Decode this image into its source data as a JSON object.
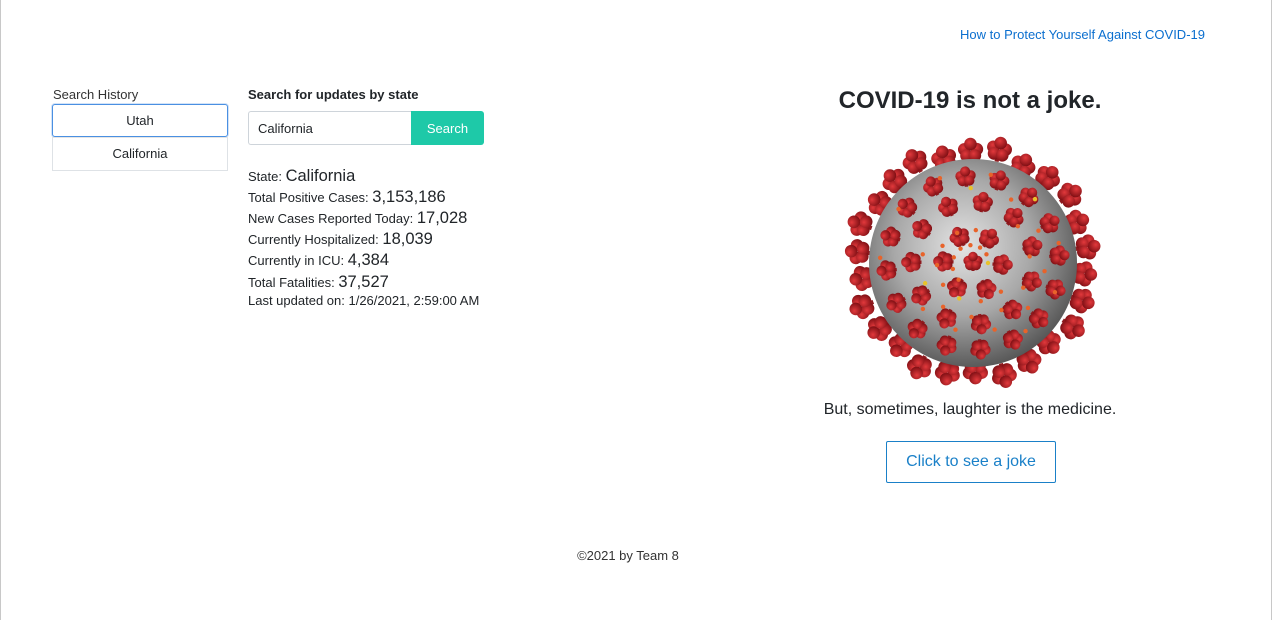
{
  "header": {
    "protect_link": "How to Protect Yourself Against COVID-19"
  },
  "history": {
    "label": "Search History",
    "items": [
      {
        "label": "Utah",
        "active": true
      },
      {
        "label": "California",
        "active": false
      }
    ]
  },
  "search": {
    "heading": "Search for updates by state",
    "input_value": "California",
    "button_label": "Search"
  },
  "stats": {
    "state_label": "State: ",
    "state_value": "California",
    "positive_label": "Total Positive Cases: ",
    "positive_value": "3,153,186",
    "new_label": "New Cases Reported Today: ",
    "new_value": "17,028",
    "hospital_label": "Currently Hospitalized: ",
    "hospital_value": "18,039",
    "icu_label": "Currently in ICU: ",
    "icu_value": "4,384",
    "fatalities_label": "Total Fatalities: ",
    "fatalities_value": "37,527",
    "updated_text": "Last updated on: 1/26/2021, 2:59:00 AM"
  },
  "joke": {
    "headline": "COVID-19 is not a joke.",
    "image_subject": "coronavirus-illustration",
    "tagline": "But, sometimes, laughter is the medicine.",
    "button_label": "Click to see a joke"
  },
  "footer": {
    "text": "©2021 by Team 8"
  },
  "colors": {
    "link": "#0b6fcf",
    "search_button": "#1ec9a8",
    "joke_button": "#1a80c8",
    "virus_body": "#9a9a9a",
    "virus_spike": "#c0232a",
    "virus_dot": "#e8632a"
  }
}
